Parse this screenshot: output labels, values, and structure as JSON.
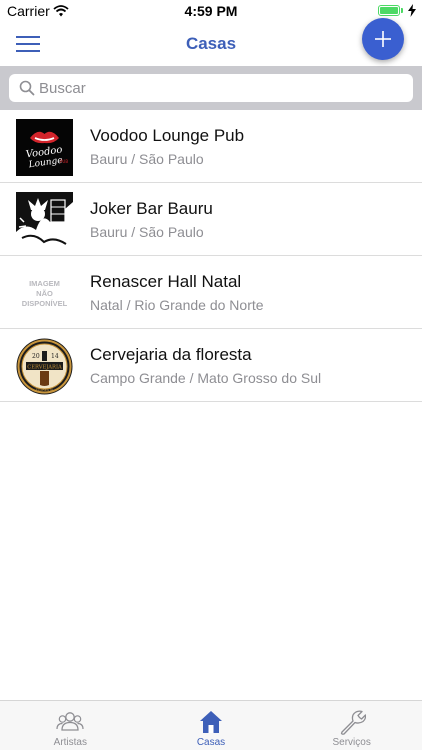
{
  "status_bar": {
    "carrier": "Carrier",
    "time": "4:59 PM",
    "battery_level": 1.0
  },
  "nav": {
    "title": "Casas",
    "menu_icon": "hamburger-menu-icon",
    "add_icon": "plus-icon",
    "accent_color": "#3d5fb8"
  },
  "search": {
    "placeholder": "Buscar",
    "value": ""
  },
  "places": [
    {
      "name": "Voodoo Lounge Pub",
      "location": "Bauru / São Paulo",
      "logo_text": "Voodoo Lounge"
    },
    {
      "name": "Joker Bar Bauru",
      "location": "Bauru / São Paulo"
    },
    {
      "name": "Renascer Hall Natal",
      "location": "Natal / Rio Grande do Norte",
      "placeholder_lines": [
        "IMAGEM",
        "NÃO",
        "DISPONÍVEL"
      ]
    },
    {
      "name": "Cervejaria da floresta",
      "location": "Campo Grande / Mato Grosso do Sul",
      "logo_text": [
        "20",
        "14",
        "CERVEJARIA",
        "FLORESTA"
      ]
    }
  ],
  "tabs": [
    {
      "label": "Artistas",
      "icon": "people-icon",
      "active": false
    },
    {
      "label": "Casas",
      "icon": "house-icon",
      "active": true
    },
    {
      "label": "Serviços",
      "icon": "wrench-icon",
      "active": false
    }
  ]
}
